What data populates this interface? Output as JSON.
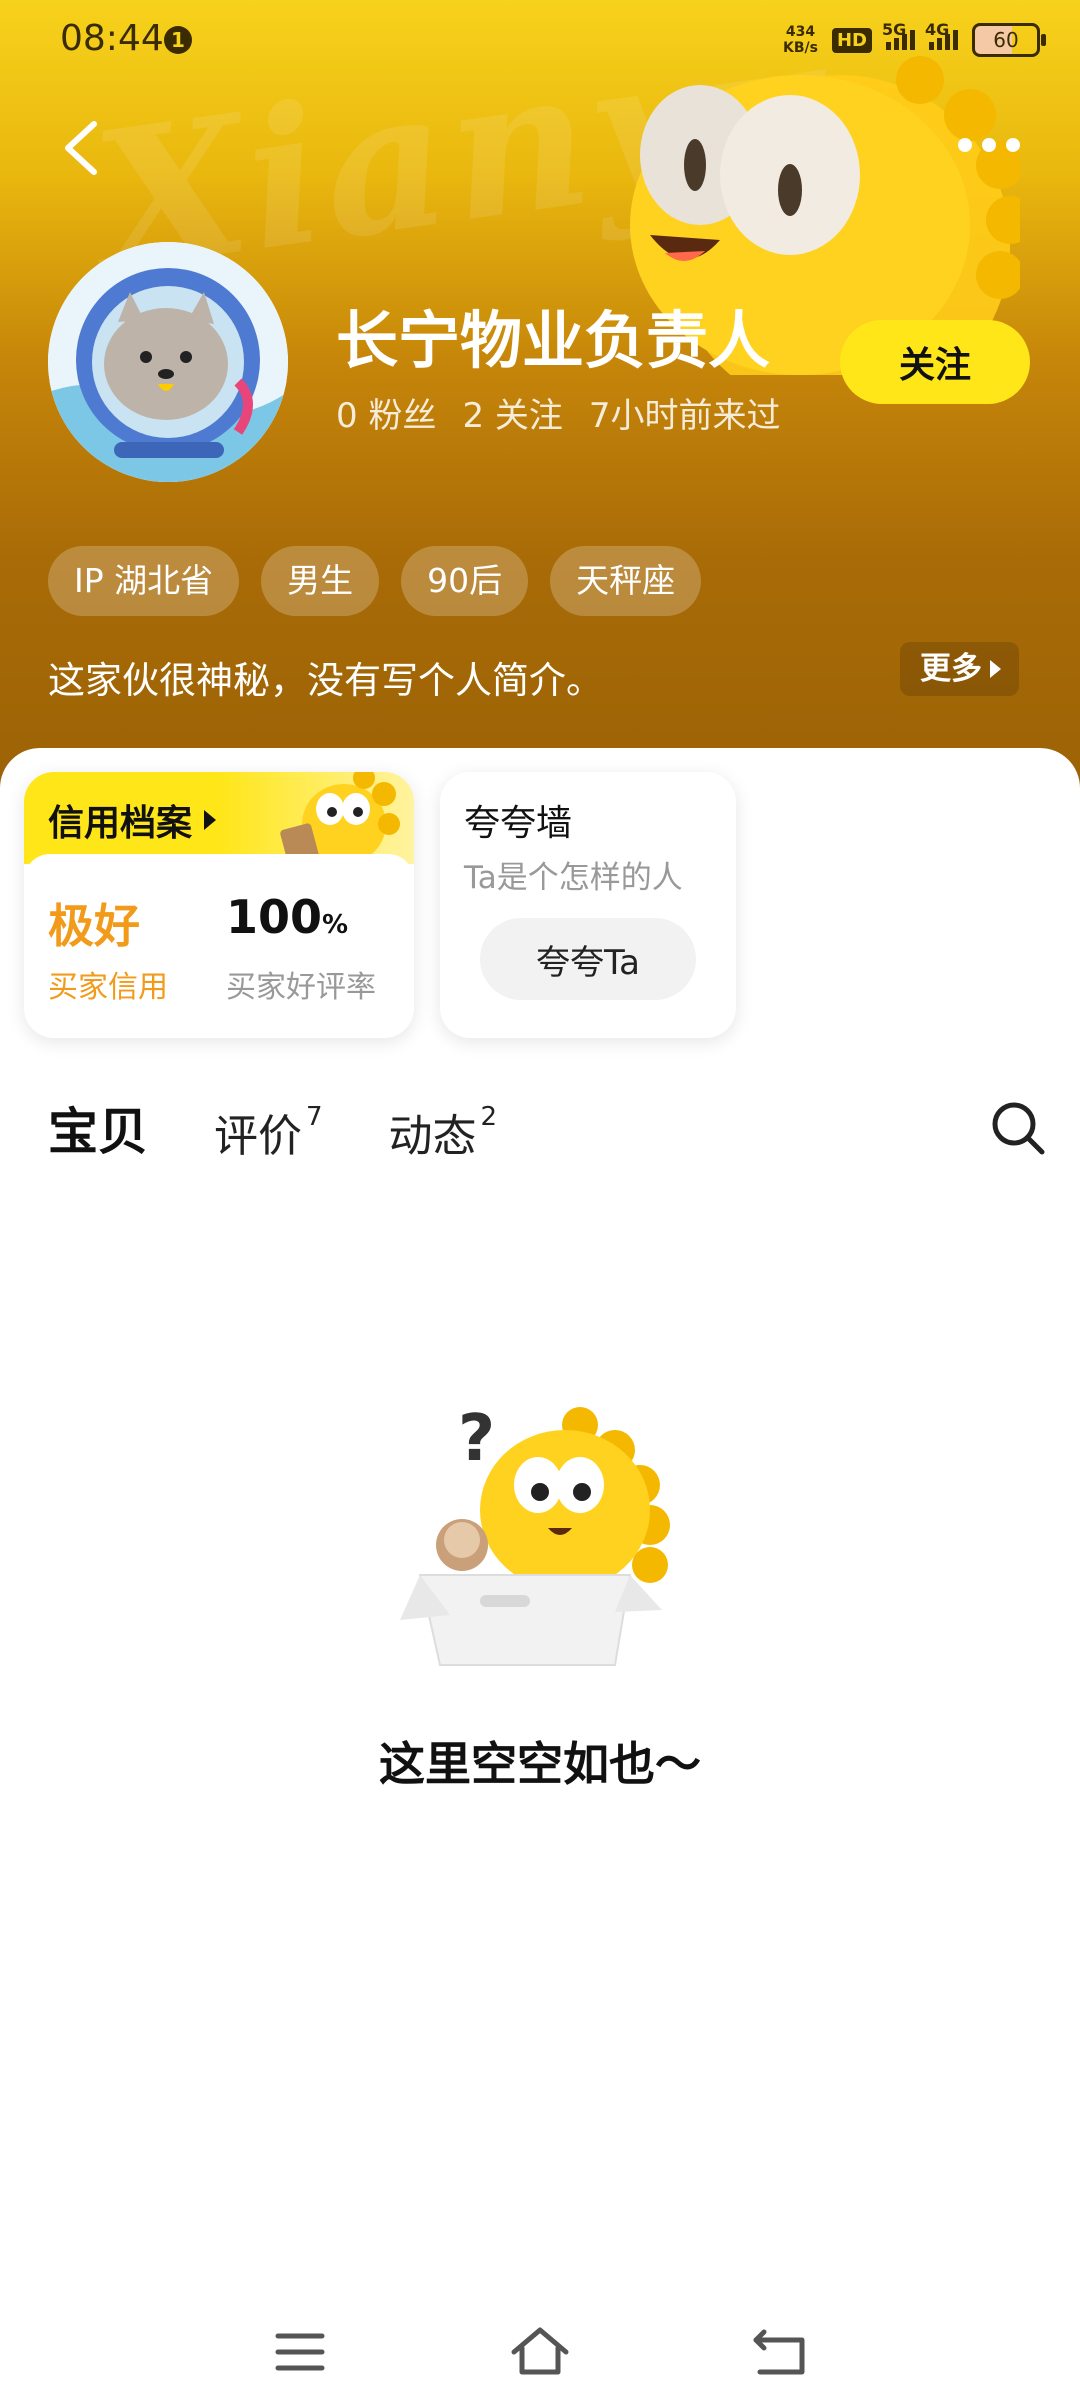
{
  "status_bar": {
    "time": "08:44",
    "notification_count": "1",
    "net_speed_value": "434",
    "net_speed_unit": "KB/s",
    "hd_label": "HD",
    "signal_1": "5G",
    "signal_2": "4G",
    "battery": "60"
  },
  "profile": {
    "name": "长宁物业负责人",
    "followers": "0 粉丝",
    "following": "2 关注",
    "last_seen": "7小时前来过",
    "follow_label": "关注",
    "tags": [
      "IP 湖北省",
      "男生",
      "90后",
      "天秤座"
    ],
    "bio": "这家伙很神秘，没有写个人简介。",
    "bio_more": "更多"
  },
  "credit_card": {
    "title": "信用档案",
    "buyer_credit_value": "极好",
    "buyer_credit_label": "买家信用",
    "rating_value": "100",
    "rating_unit": "%",
    "rating_label": "买家好评率"
  },
  "praise_card": {
    "title": "夸夸墙",
    "subtitle": "Ta是个怎样的人",
    "button": "夸夸Ta"
  },
  "tabs": [
    {
      "label": "宝贝",
      "count": ""
    },
    {
      "label": "评价",
      "count": "7"
    },
    {
      "label": "动态",
      "count": "2"
    }
  ],
  "empty_state": {
    "message": "这里空空如也～"
  },
  "colors": {
    "accent_yellow": "#ffe619",
    "credit_orange": "#f29a1a"
  }
}
